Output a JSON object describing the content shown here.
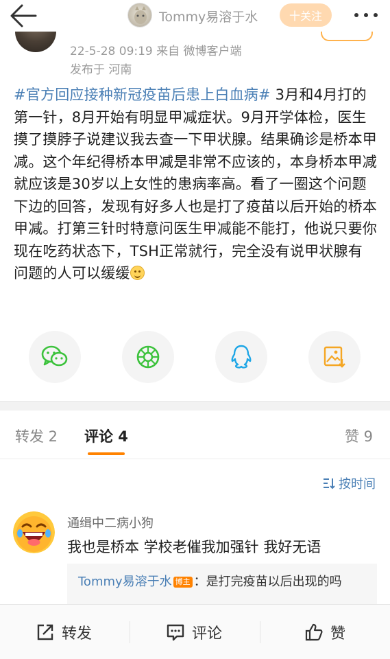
{
  "header": {
    "username": "Tommy易溶于水",
    "follow_label": "十关注"
  },
  "post": {
    "date_source": "22-5-28 09:19   来自 微博客户端",
    "location": "发布于 河南",
    "hashtag": "#官方回应接种新冠疫苗后患上白血病#",
    "text": "  3月和4月打的第一针，8月开始有明显甲减症状。9月开学体检，医生摸了摸脖子说建议我去查一下甲状腺。结果确诊是桥本甲减。这个年纪得桥本甲减是非常不应该的，本身桥本甲减就应该是30岁以上女性的患病率高。看了一圈这个问题下边的回答，发现有好多人也是打了疫苗以后开始的桥本甲减。打第三针时特意问医生甲减能不能打，他说只要你现在吃药状态下，TSH正常就行，完全没有说甲状腺有问题的人可以缓缓",
    "emoji": "smile-emoji"
  },
  "share": {
    "icons": [
      "wechat-icon",
      "moments-icon",
      "qq-icon",
      "save-image-icon"
    ],
    "colors": {
      "wechat": "#3cc23c",
      "moments": "#3cc23c",
      "qq": "#1ea6e6",
      "save": "#f5a623"
    }
  },
  "tabs": {
    "repost": "转发 2",
    "comments": "评论 4",
    "likes": "赞 9"
  },
  "sort_label": "按时间",
  "comment": {
    "username": "通缉中二病小狗",
    "text": "我也是桥本 学校老催我加强针 我好无语",
    "reply": {
      "username": "Tommy易溶于水",
      "badge": "博主",
      "text": "：是打完疫苗以后出现的吗"
    }
  },
  "bottom": {
    "repost": "转发",
    "comment": "评论",
    "like": "赞"
  },
  "colors": {
    "accent": "#ff8200",
    "link": "#4a7fb5"
  }
}
